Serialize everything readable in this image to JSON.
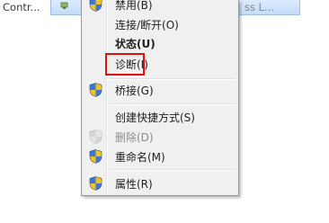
{
  "background": {
    "left_text": "Contr...",
    "right_text": "ss L..."
  },
  "menu": {
    "items": [
      {
        "label": "禁用(B)",
        "icon": "uac-shield-icon",
        "bold": false,
        "disabled": false
      },
      {
        "label": "连接/断开(O)",
        "icon": "",
        "bold": false,
        "disabled": false
      },
      {
        "label": "状态(U)",
        "icon": "",
        "bold": true,
        "disabled": false
      },
      {
        "label": "诊断(I)",
        "icon": "",
        "bold": false,
        "disabled": false
      },
      {
        "label": "桥接(G)",
        "icon": "uac-shield-icon",
        "bold": false,
        "disabled": false
      },
      {
        "label": "创建快捷方式(S)",
        "icon": "",
        "bold": false,
        "disabled": false
      },
      {
        "label": "删除(D)",
        "icon": "uac-shield-icon",
        "bold": false,
        "disabled": true
      },
      {
        "label": "重命名(M)",
        "icon": "uac-shield-icon",
        "bold": false,
        "disabled": false
      },
      {
        "label": "属性(R)",
        "icon": "uac-shield-icon",
        "bold": false,
        "disabled": false
      }
    ],
    "highlighted_item": "诊断(I)"
  },
  "colors": {
    "highlight_border": "#e10e0e",
    "menu_background": "#f0f0f0"
  }
}
